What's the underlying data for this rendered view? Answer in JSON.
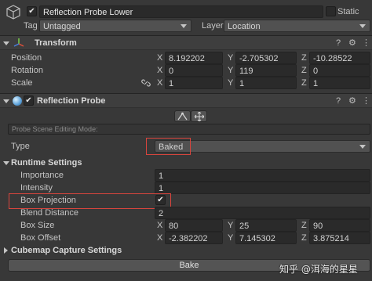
{
  "header": {
    "object_name": "Reflection Probe Lower",
    "static_label": "Static",
    "tag_label": "Tag",
    "tag_value": "Untagged",
    "layer_label": "Layer",
    "layer_value": "Location"
  },
  "transform": {
    "title": "Transform",
    "position": {
      "label": "Position",
      "x": "8.192202",
      "y": "-2.705302",
      "z": "-10.28522"
    },
    "rotation": {
      "label": "Rotation",
      "x": "0",
      "y": "119",
      "z": "0"
    },
    "scale": {
      "label": "Scale",
      "x": "1",
      "y": "1",
      "z": "1"
    }
  },
  "axes": {
    "x": "X",
    "y": "Y",
    "z": "Z"
  },
  "reflection_probe": {
    "title": "Reflection Probe",
    "mode_placeholder": "Probe Scene Editing Mode:",
    "type_label": "Type",
    "type_value": "Baked",
    "runtime_title": "Runtime Settings",
    "importance": {
      "label": "Importance",
      "value": "1"
    },
    "intensity": {
      "label": "Intensity",
      "value": "1"
    },
    "box_projection": {
      "label": "Box Projection",
      "checked": "✔"
    },
    "blend_distance": {
      "label": "Blend Distance",
      "value": "2"
    },
    "box_size": {
      "label": "Box Size",
      "x": "80",
      "y": "25",
      "z": "90"
    },
    "box_offset": {
      "label": "Box Offset",
      "x": "-2.382202",
      "y": "7.145302",
      "z": "3.875214"
    },
    "cubemap_title": "Cubemap Capture Settings",
    "bake_label": "Bake"
  },
  "watermark": "知乎 @洱海的星星",
  "colors": {
    "background": "#383838",
    "field": "#2a2a2a",
    "highlight": "#d9453d"
  }
}
